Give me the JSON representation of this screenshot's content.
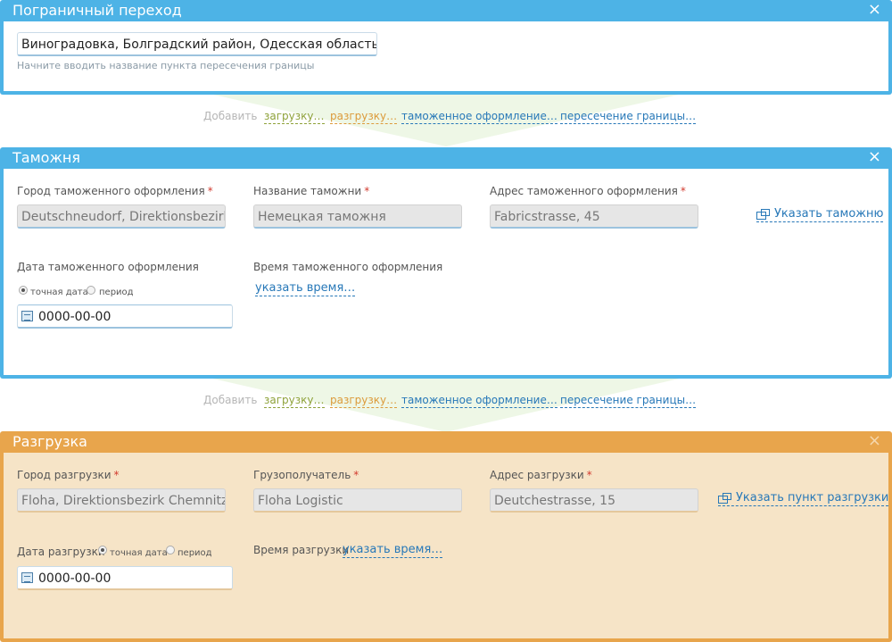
{
  "border_crossing": {
    "title": "Пограничный переход",
    "close_icon": "×",
    "value": "Виноградовка, Болградский район, Одесская область",
    "hint": "Начните вводить название пункта пересечения границы"
  },
  "add_bar": {
    "label": "Добавить",
    "loading": "загрузку…",
    "unloading": "разгрузку…",
    "customs": "таможенное оформление…",
    "border": "пересечение границы…"
  },
  "customs": {
    "title": "Таможня",
    "close_icon": "×",
    "city_label": "Город таможенного оформления",
    "city_value": "Deutschneudorf, Direktionsbezirk Chemnitz",
    "name_label": "Название таможни",
    "name_value": "Немецкая таможня",
    "address_label": "Адрес таможенного оформления",
    "address_value": "Fabricstrasse, 45",
    "specify_link": "Указать таможню",
    "date_label": "Дата таможенного оформления",
    "radio_exact": "точная дата",
    "radio_period": "период",
    "date_value": "0000-00-00",
    "time_label": "Время таможенного оформления",
    "time_link": "указать время…"
  },
  "unloading": {
    "title": "Разгрузка",
    "close_icon": "×",
    "city_label": "Город разгрузки",
    "city_value": "Floha, Direktionsbezirk Chemnitz, Sachsen",
    "consignee_label": "Грузополучатель",
    "consignee_value": "Floha Logistic",
    "address_label": "Адрес разгрузки",
    "address_value": "Deutchestrasse, 15",
    "specify_link": "Указать пункт разгрузки",
    "date_label": "Дата разгрузки",
    "radio_exact": "точная дата",
    "radio_period": "период",
    "date_value": "0000-00-00",
    "time_label": "Время разгрузки",
    "time_link": "указать время…"
  },
  "required_mark": "*",
  "colors": {
    "blue_header": "#4db3e6",
    "orange_header": "#e8a54c",
    "orange_body": "#f6e4c7",
    "link_blue": "#2778b8",
    "link_green": "#8ea23a",
    "link_orange": "#dc9b3b",
    "required_red": "#d23a2e"
  }
}
